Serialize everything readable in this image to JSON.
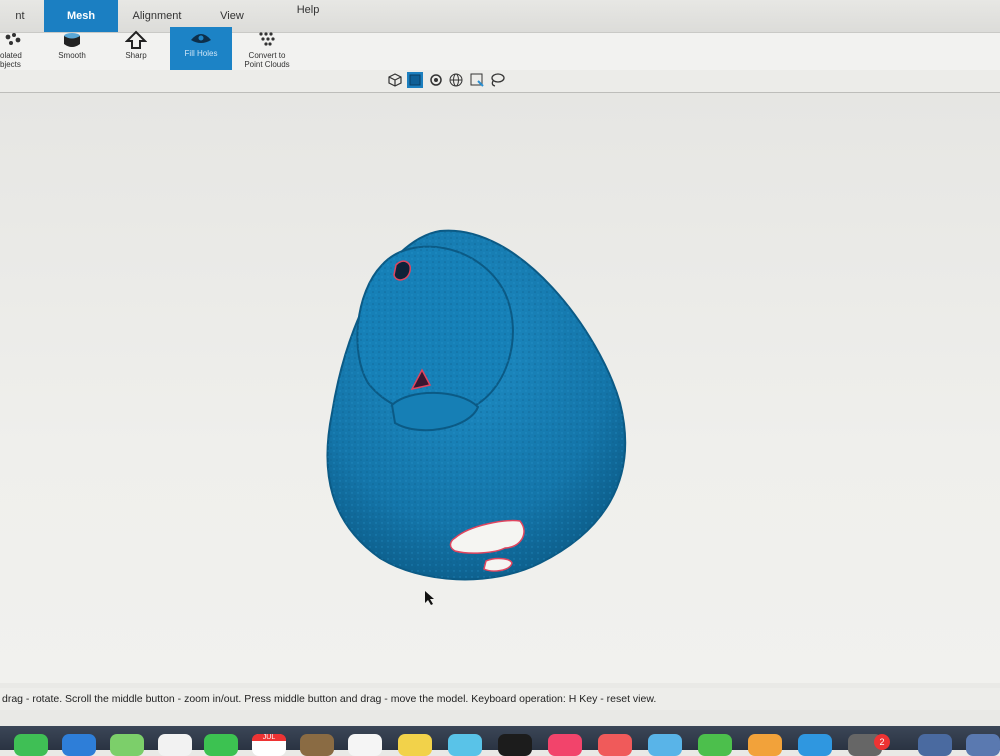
{
  "menu": {
    "tabs": [
      {
        "label": "nt Cloud"
      },
      {
        "label": "Mesh"
      },
      {
        "label": "Alignment"
      },
      {
        "label": "View"
      },
      {
        "label": "Help"
      }
    ]
  },
  "ribbon": {
    "tools": [
      {
        "label": "olated\nbjects",
        "icon": "isolated-objects-icon"
      },
      {
        "label": "Smooth",
        "icon": "smooth-icon"
      },
      {
        "label": "Sharp",
        "icon": "sharp-icon"
      },
      {
        "label": "Fill Holes",
        "icon": "fill-holes-icon"
      },
      {
        "label": "Convert to\nPoint Clouds",
        "icon": "convert-to-point-cloud-icon"
      }
    ]
  },
  "viewbar": {
    "icons": [
      "cube-view-icon",
      "solid-view-icon",
      "texture-view-icon",
      "wireframe-view-icon",
      "select-view-icon",
      "lasso-view-icon"
    ]
  },
  "status": {
    "text": "drag - rotate. Scroll the middle button - zoom in/out. Press middle button and drag - move the model. Keyboard operation: H Key - reset view."
  },
  "dock": {
    "calendar_month": "JUL",
    "badge_count": "2"
  },
  "colors": {
    "accent": "#1b7fc2",
    "mesh": "#1479ad",
    "hole_outline": "#e0455f"
  }
}
